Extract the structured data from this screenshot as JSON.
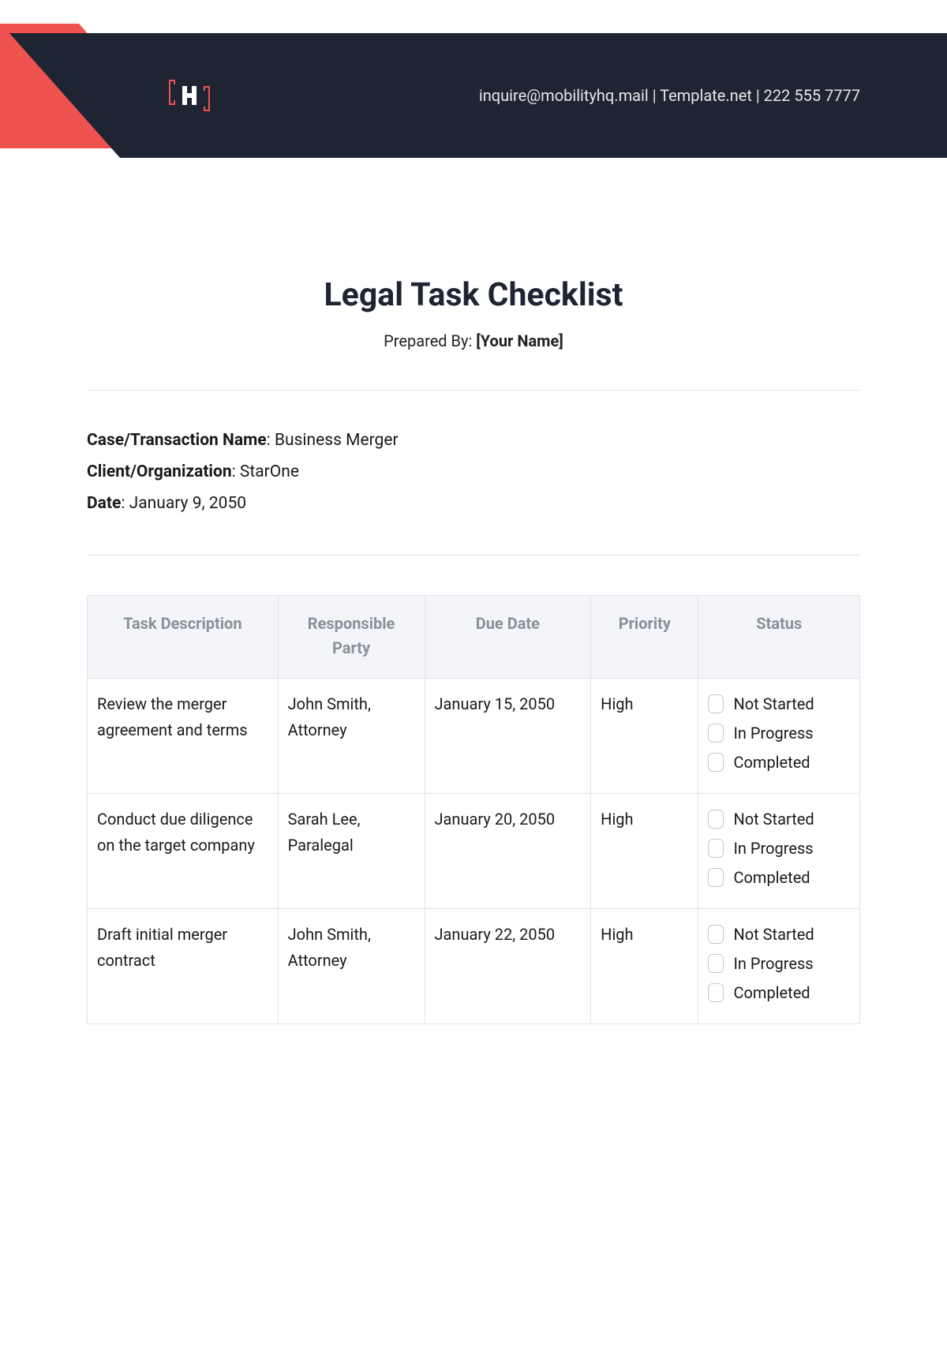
{
  "header": {
    "email": "inquire@mobilityhq.mail",
    "site": "Template.net",
    "phone": "222 555 7777",
    "sep": "  |  "
  },
  "document": {
    "title": "Legal Task Checklist",
    "prepared_label": "Prepared By: ",
    "prepared_value": "[Your Name]"
  },
  "meta": {
    "case_label": "Case/Transaction Name",
    "case_value": "Business Merger",
    "client_label": "Client/Organization",
    "client_value": "StarOne",
    "date_label": "Date",
    "date_value": "January 9, 2050"
  },
  "table": {
    "headers": {
      "desc": "Task Description",
      "resp": "Responsible Party",
      "due": "Due Date",
      "pri": "Priority",
      "stat": "Status"
    },
    "status_options": [
      "Not Started",
      "In Progress",
      "Completed"
    ],
    "rows": [
      {
        "desc": "Review the merger agreement and terms",
        "resp": "John Smith, Attorney",
        "due": "January 15, 2050",
        "pri": "High"
      },
      {
        "desc": "Conduct due diligence on the target company",
        "resp": "Sarah Lee, Paralegal",
        "due": "January 20, 2050",
        "pri": "High"
      },
      {
        "desc": "Draft initial merger contract",
        "resp": "John Smith, Attorney",
        "due": "January 22, 2050",
        "pri": "High"
      }
    ]
  }
}
